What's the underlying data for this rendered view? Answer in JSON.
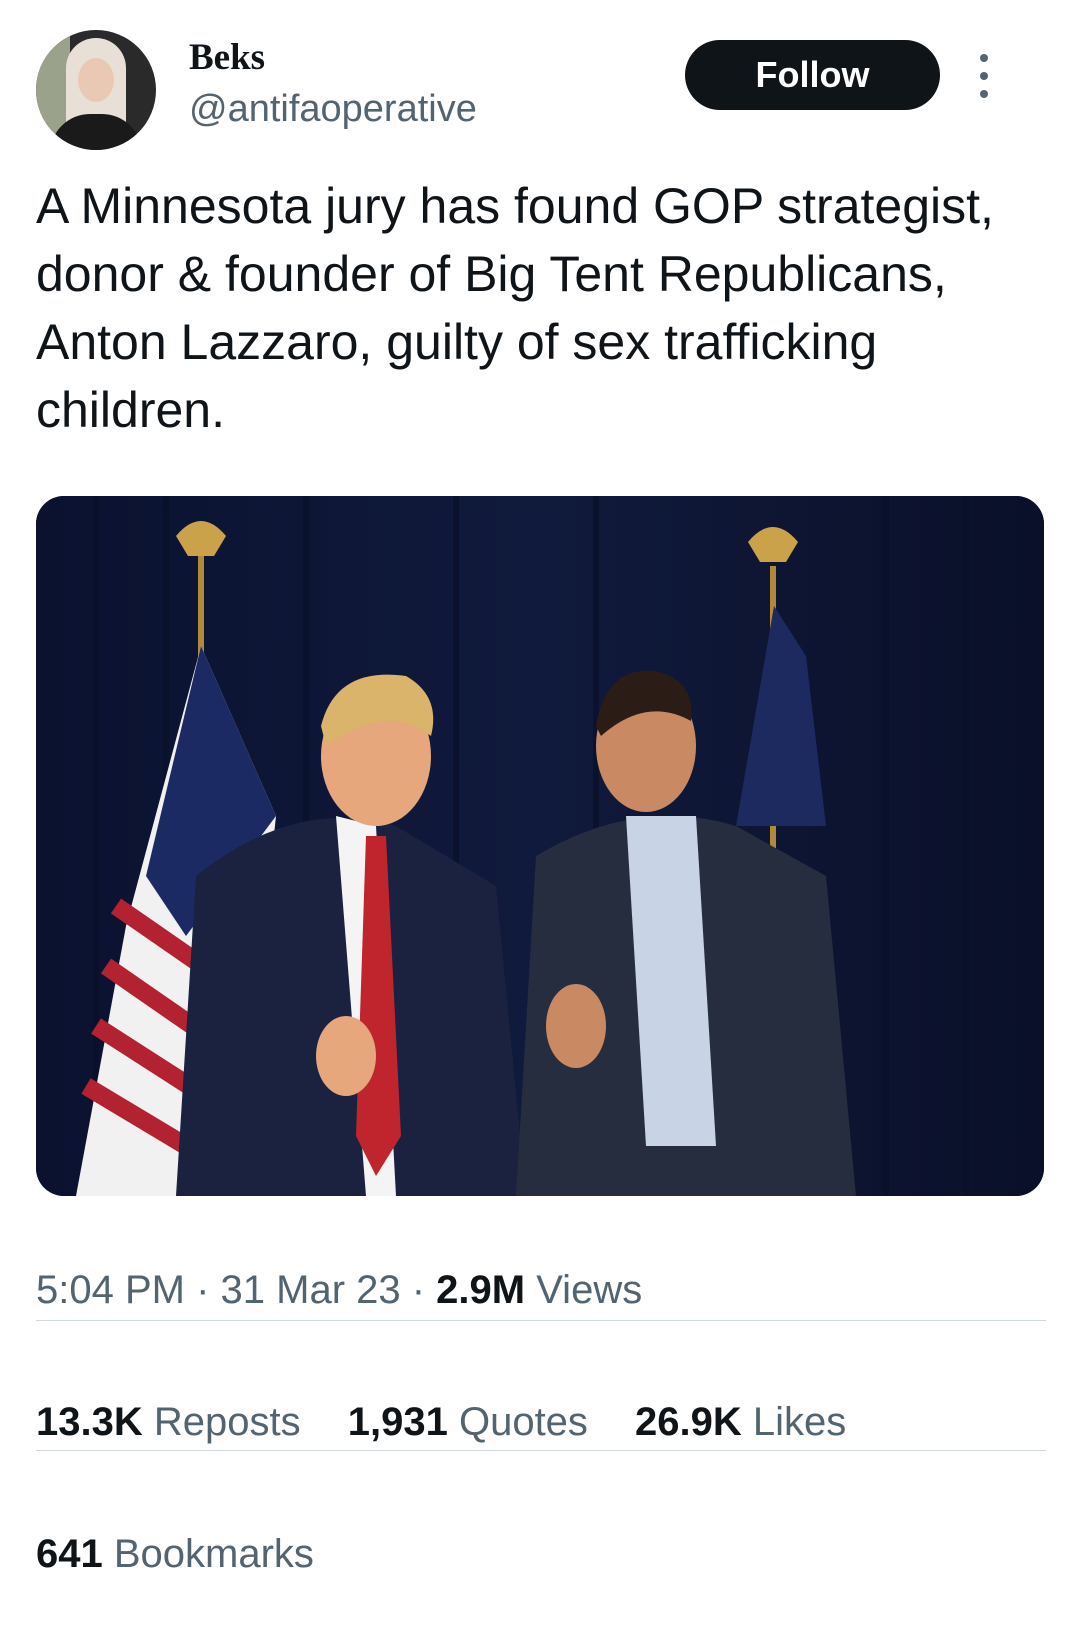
{
  "user": {
    "name": "Beks",
    "handle": "@antifaoperative",
    "avatar_icon": "profile-photo"
  },
  "follow_label": "Follow",
  "more_icon": "more-vertical-icon",
  "tweet": {
    "text": "A Minnesota jury has found GOP strategist, donor & founder of Big Tent Republicans, Anton Lazzaro, guilty of sex trafficking children."
  },
  "media": {
    "icon": "photo"
  },
  "meta": {
    "time": "5:04 PM",
    "sep1": " · ",
    "date": "31 Mar 23",
    "sep2": " · ",
    "views_count": "2.9M",
    "views_label": " Views"
  },
  "stats": {
    "reposts": {
      "count": "13.3K",
      "label": " Reposts"
    },
    "quotes": {
      "count": "1,931",
      "label": " Quotes"
    },
    "likes": {
      "count": "26.9K",
      "label": " Likes"
    },
    "bookmarks": {
      "count": "641",
      "label": " Bookmarks"
    }
  },
  "colors": {
    "text": "#0f1419",
    "secondary": "#536471",
    "divider": "#cfd9de",
    "follow_bg": "#0f1419"
  }
}
